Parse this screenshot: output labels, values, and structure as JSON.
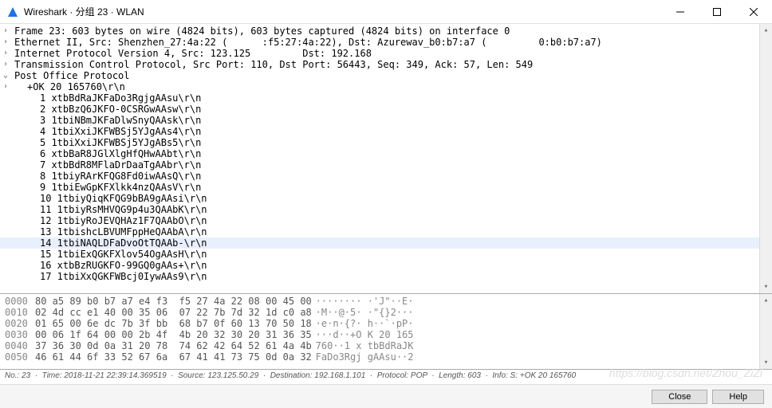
{
  "title": "Wireshark · 分组 23 · WLAN",
  "tree": {
    "frame": "Frame 23: 603 bytes on wire (4824 bits), 603 bytes captured (4824 bits) on interface 0",
    "eth": "Ethernet II, Src: Shenzhen_27:4a:22 (      :f5:27:4a:22), Dst: Azurewav_b0:b7:a7 (         0:b0:b7:a7)",
    "ip": "Internet Protocol Version 4, Src: 123.125         Dst: 192.168",
    "tcp": "Transmission Control Protocol, Src Port: 110, Dst Port: 56443, Seq: 349, Ack: 57, Len: 549",
    "pop": "Post Office Protocol",
    "pop_child": "+OK 20 165760\\r\\n",
    "lines": [
      "1 xtbBdRaJKFaDo3RgjgAAsu\\r\\n",
      "2 xtbBzQ6JKFO-0CSRGwAAsw\\r\\n",
      "3 1tbiNBmJKFaDlwSnyQAAsk\\r\\n",
      "4 1tbiXxiJKFWBSj5YJgAAs4\\r\\n",
      "5 1tbiXxiJKFWBSj5YJgABs5\\r\\n",
      "6 xtbBaR8JGlXlgHfQHwAAbt\\r\\n",
      "7 xtbBdR8MFlaDrDaaTgAAbr\\r\\n",
      "8 1tbiyRArKFQG8Fd0iwAAsQ\\r\\n",
      "9 1tbiEwGpKFXlkk4nzQAAsV\\r\\n",
      "10 1tbiyQiqKFQG9bBA9gAAsi\\r\\n",
      "11 1tbiyRsMHVQG9p4u3QAAbK\\r\\n",
      "12 1tbiyRoJEVQHAz1F7QAAbO\\r\\n",
      "13 1tbishcLBVUMFppHeQAAbA\\r\\n",
      "14 1tbiNAQLDFaDvoOtTQAAb-\\r\\n",
      "15 1tbiExQGKFXlov54OgAAsH\\r\\n",
      "16 xtbBzRUGKFO-99GQ0gAAs+\\r\\n",
      "17 1tbiXxQGKFWBcj0IywAAs9\\r\\n"
    ]
  },
  "hex": [
    {
      "off": "0000",
      "h": "80 a5 89 b0 b7 a7 e4 f3  f5 27 4a 22 08 00 45 00",
      "a": "········ ·'J\"··E·"
    },
    {
      "off": "0010",
      "h": "02 4d cc e1 40 00 35 06  07 22 7b 7d 32 1d c0 a8",
      "a": "·M··@·5· ·\"{}2···"
    },
    {
      "off": "0020",
      "h": "01 65 00 6e dc 7b 3f bb  68 b7 0f 60 13 70 50 18",
      "a": "·e·n·{?· h··`·pP·"
    },
    {
      "off": "0030",
      "h": "00 06 1f 64 00 00 2b 4f  4b 20 32 30 20 31 36 35",
      "a": "···d··+O K 20 165"
    },
    {
      "off": "0040",
      "h": "37 36 30 0d 0a 31 20 78  74 62 42 64 52 61 4a 4b",
      "a": "760··1 x tbBdRaJK"
    },
    {
      "off": "0050",
      "h": "46 61 44 6f 33 52 67 6a  67 41 41 73 75 0d 0a 32",
      "a": "FaDo3Rgj gAAsu··2"
    }
  ],
  "status": "No.: 23  ·  Time: 2018-11-21 22:39:14.369519  ·  Source: 123.125.50.29  ·  Destination: 192.168.1.101  ·  Protocol: POP  ·  Length: 603  ·  Info: S: +OK 20 165760",
  "buttons": {
    "close": "Close",
    "help": "Help"
  },
  "watermark": "https://blog.csdn.net/Zhou_ZiZi"
}
